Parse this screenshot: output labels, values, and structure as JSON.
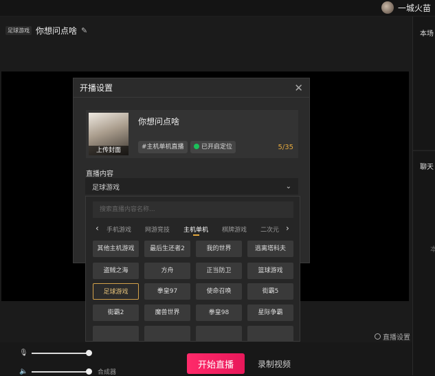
{
  "topbar": {
    "username": "一城火苗"
  },
  "room": {
    "category_tag": "足球游戏",
    "title": "你想问点啥"
  },
  "right_panel": {
    "tab_top": "本场",
    "tab_chat": "聊天",
    "faint_text": "本"
  },
  "dialog": {
    "title": "开播设置",
    "close": "✕",
    "cover_label": "上传封面",
    "live_title": "你想问点啥",
    "topic_tag": "#主机单机直播",
    "location_label": "已开启定位",
    "char_count": "5/35",
    "content_label": "直播内容"
  },
  "content_select": {
    "value": "足球游戏",
    "chevron": "⌄"
  },
  "dropdown": {
    "search_placeholder": "搜索直播内容名称...",
    "categories": [
      "手机游戏",
      "网游竞技",
      "主机单机",
      "棋牌游戏",
      "二次元"
    ],
    "active_category": "主机单机",
    "games": [
      "其他主机游戏",
      "最后生还者2",
      "我的世界",
      "逃离塔科夫",
      "盗贼之海",
      "方舟",
      "正当防卫",
      "篮球游戏",
      "足球游戏",
      "拳皇97",
      "使命召唤",
      "街霸5",
      "街霸2",
      "魔兽世界",
      "拳皇98",
      "星际争霸"
    ],
    "selected_game": "足球游戏"
  },
  "bottom": {
    "live_settings": "直播设置",
    "mixer_label": "合成器",
    "start_live": "开始直播",
    "record_video": "录制视频"
  },
  "colors": {
    "accent": "#e8185a",
    "highlight": "#e5a93d",
    "location_dot": "#1bc05a"
  }
}
